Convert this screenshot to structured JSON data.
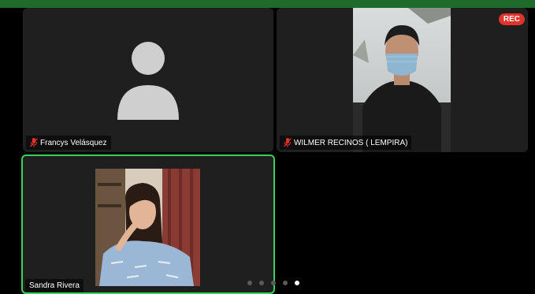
{
  "meeting": {
    "recording_badge": "REC",
    "page_count": 5,
    "current_page": 5
  },
  "participants": [
    {
      "name": "Francys Velásquez",
      "muted": true,
      "video": false
    },
    {
      "name": "WILMER RECINOS ( LEMPIRA)",
      "muted": true,
      "video": true
    },
    {
      "name": "Sandra Rivera",
      "muted": false,
      "video": true,
      "active_speaker": true
    }
  ],
  "colors": {
    "top_bar": "#1f6b2b",
    "tile_bg": "#1f1f1f",
    "active_border": "#3ad15a",
    "rec": "#e0332a",
    "muted_icon": "#e0332a"
  }
}
